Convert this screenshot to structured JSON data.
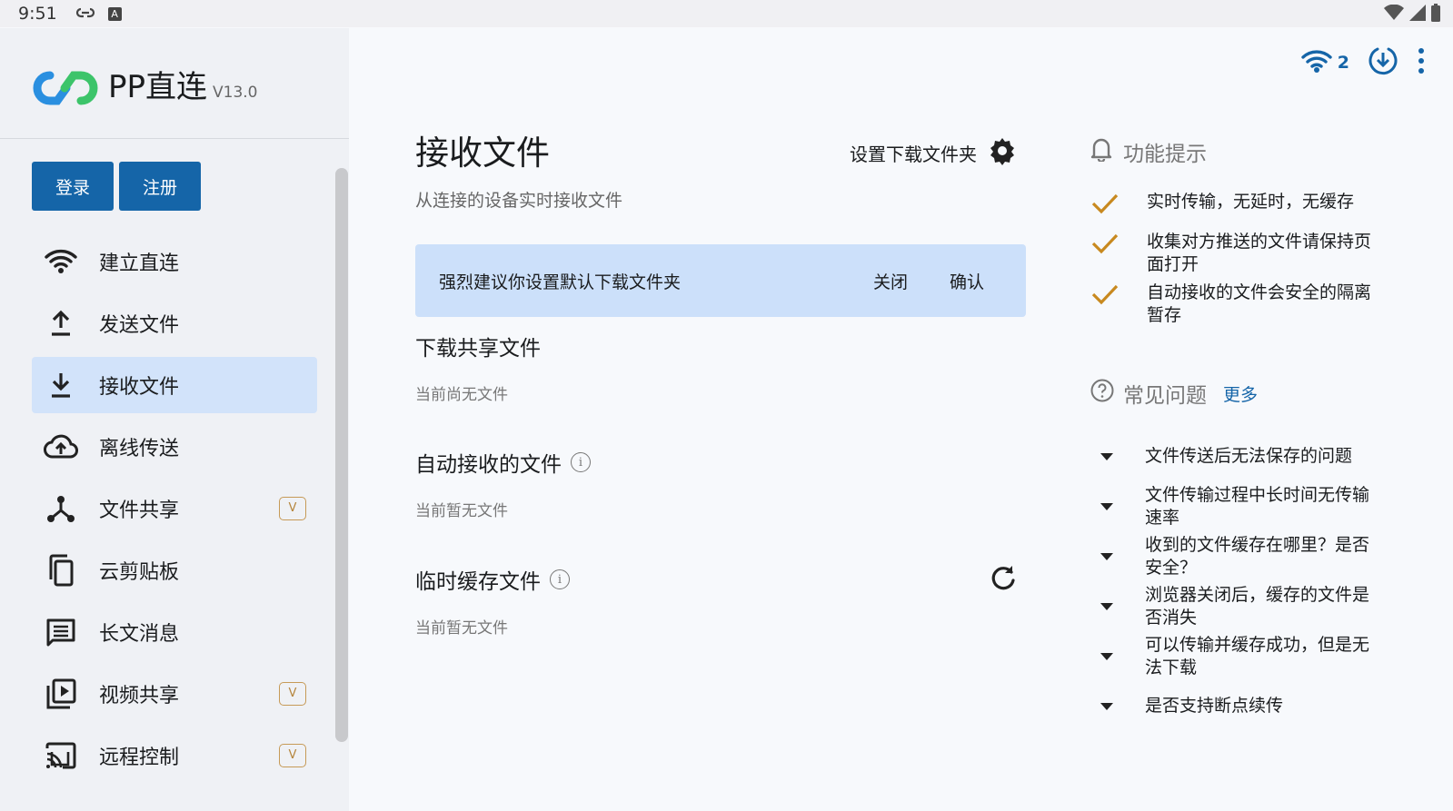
{
  "statusbar": {
    "time": "9:51",
    "a_label": "A"
  },
  "brand": {
    "name": "PP直连",
    "version": "V13.0"
  },
  "auth": {
    "login": "登录",
    "register": "注册"
  },
  "nav": [
    {
      "label": "建立直连",
      "icon": "wifi-icon",
      "active": false,
      "vip": ""
    },
    {
      "label": "发送文件",
      "icon": "upload-icon",
      "active": false,
      "vip": ""
    },
    {
      "label": "接收文件",
      "icon": "download-icon",
      "active": true,
      "vip": ""
    },
    {
      "label": "离线传送",
      "icon": "cloud-upload-icon",
      "active": false,
      "vip": ""
    },
    {
      "label": "文件共享",
      "icon": "share-icon",
      "active": false,
      "vip": "V"
    },
    {
      "label": "云剪贴板",
      "icon": "copy-icon",
      "active": false,
      "vip": ""
    },
    {
      "label": "长文消息",
      "icon": "message-icon",
      "active": false,
      "vip": ""
    },
    {
      "label": "视频共享",
      "icon": "video-icon",
      "active": false,
      "vip": "V"
    },
    {
      "label": "远程控制",
      "icon": "cast-icon",
      "active": false,
      "vip": "V"
    }
  ],
  "top_actions": {
    "connection_count": "2"
  },
  "main": {
    "title": "接收文件",
    "subtitle": "从连接的设备实时接收文件",
    "set_folder": "设置下载文件夹",
    "banner": {
      "message": "强烈建议你设置默认下载文件夹",
      "close": "关闭",
      "confirm": "确认"
    },
    "sections": [
      {
        "title": "下载共享文件",
        "empty": "当前尚无文件"
      },
      {
        "title": "自动接收的文件",
        "empty": "当前暂无文件"
      },
      {
        "title": "临时缓存文件",
        "empty": "当前暂无文件"
      }
    ]
  },
  "tips": {
    "title": "功能提示",
    "items": [
      "实时传输，无延时，无缓存",
      "收集对方推送的文件请保持页面打开",
      "自动接收的文件会安全的隔离暂存"
    ]
  },
  "faq": {
    "title": "常见问题",
    "more": "更多",
    "items": [
      "文件传送后无法保存的问题",
      "文件传输过程中长时间无传输速率",
      "收到的文件缓存在哪里？是否安全？",
      "浏览器关闭后，缓存的文件是否消失",
      "可以传输并缓存成功，但是无法下载",
      "是否支持断点续传"
    ]
  },
  "colors": {
    "primary": "#1565a8",
    "active_bg": "#d2e3fa",
    "banner_bg": "#cce0fa",
    "check": "#c8891f",
    "vip": "#c69a57"
  }
}
